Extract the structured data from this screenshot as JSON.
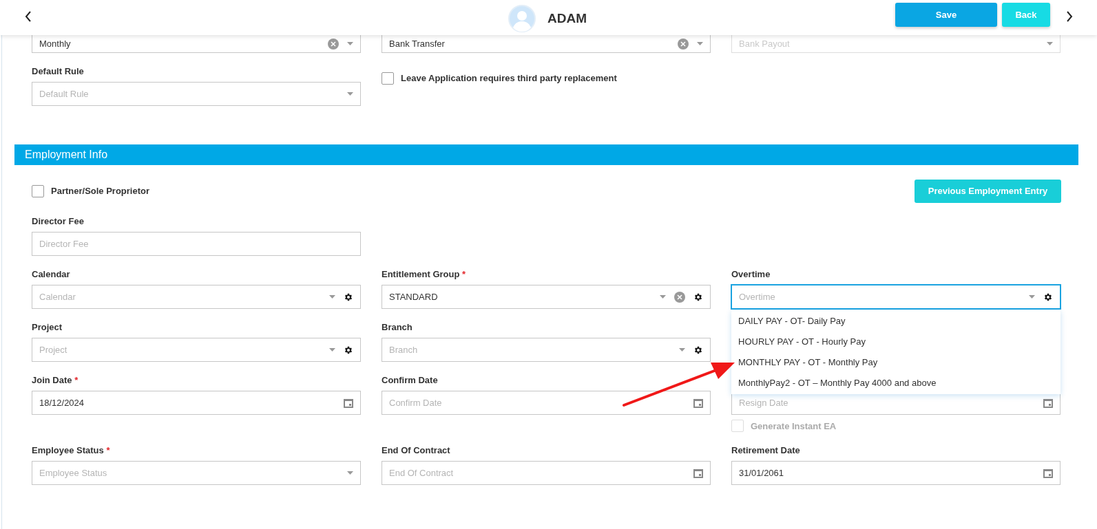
{
  "header": {
    "title": "ADAM",
    "buttons": [
      {
        "label": "Save",
        "kind": "primary"
      },
      {
        "label": "Back",
        "kind": "secondary"
      }
    ]
  },
  "top_rows": [
    [
      {
        "kind": "select",
        "value": "Monthly",
        "clearable": true
      },
      {
        "kind": "select",
        "value": "Bank Transfer",
        "clearable": true
      },
      {
        "kind": "select",
        "placeholder": "Bank Payout",
        "disabled": true
      }
    ],
    [
      {
        "kind": "select",
        "label": "Default Rule",
        "placeholder": "Default Rule"
      },
      {
        "kind": "checkbox",
        "label": "Leave Application requires third party replacement",
        "checked": false
      }
    ]
  ],
  "employment": {
    "title": "Employment Info",
    "partner": {
      "label": "Partner/Sole Proprietor",
      "checked": false
    },
    "previous_button": "Previous Employment Entry",
    "rows": [
      [
        {
          "kind": "text",
          "label": "Director Fee",
          "placeholder": "Director Fee"
        }
      ],
      [
        {
          "kind": "select",
          "label": "Calendar",
          "placeholder": "Calendar",
          "gear": true
        },
        {
          "kind": "select",
          "label": "Entitlement Group",
          "required_mark": "*",
          "value": "STANDARD",
          "clearable": true,
          "gear": true
        },
        {
          "kind": "select",
          "label": "Overtime",
          "placeholder": "Overtime",
          "gear": true,
          "focused": true,
          "options": [
            {
              "label": "DAILY PAY - OT- Daily Pay",
              "selected": false
            },
            {
              "label": "HOURLY PAY - OT - Hourly Pay",
              "selected": false
            },
            {
              "label": "MONTHLY PAY - OT - Monthly Pay",
              "selected": false
            },
            {
              "label": "MonthlyPay2 - OT – Monthly Pay 4000 and above",
              "selected": false
            }
          ]
        }
      ],
      [
        {
          "kind": "select",
          "label": "Project",
          "placeholder": "Project",
          "gear": true
        },
        {
          "kind": "select",
          "label": "Branch",
          "placeholder": "Branch",
          "gear": true
        },
        {
          "kind": "blank"
        }
      ],
      [
        {
          "kind": "date",
          "label": "Join Date",
          "required_mark": "*",
          "value": "18/12/2024"
        },
        {
          "kind": "date",
          "label": "Confirm Date",
          "placeholder": "Confirm Date"
        },
        {
          "kind": "date",
          "placeholder": "Resign Date",
          "checkbox": {
            "label": "Generate Instant EA",
            "checked": false,
            "disabled": true
          }
        }
      ],
      [
        {
          "kind": "select",
          "label": "Employee Status",
          "required_mark": "*",
          "placeholder": "Employee Status"
        },
        {
          "kind": "date",
          "label": "End Of Contract",
          "placeholder": "End Of Contract"
        },
        {
          "kind": "date",
          "label": "Retirement Date",
          "value": "31/01/2061"
        }
      ]
    ]
  }
}
